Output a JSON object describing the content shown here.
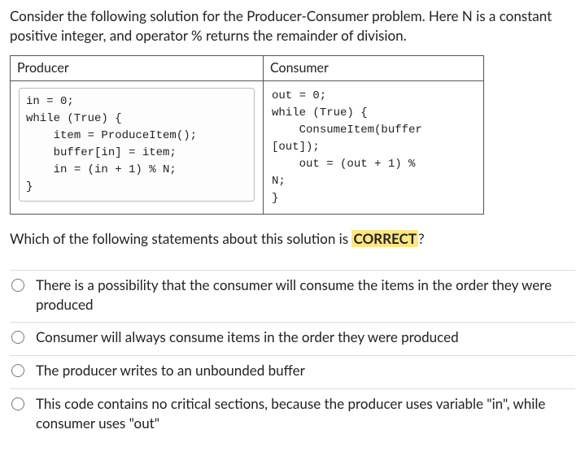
{
  "intro": "Consider the following solution for the Producer-Consumer problem. Here N is a constant positive integer, and operator % returns the remainder of division.",
  "table": {
    "headers": {
      "producer": "Producer",
      "consumer": "Consumer"
    },
    "producer_code": "in = 0;\nwhile (True) {\n    item = ProduceItem();\n    buffer[in] = item;\n    in = (in + 1) % N;\n}",
    "consumer_code": "out = 0;\nwhile (True) {\n    ConsumeItem(buffer\n[out]);\n    out = (out + 1) % \nN;\n}"
  },
  "question_prefix": "Which of the following statements about this solution is ",
  "question_highlight": "CORRECT",
  "question_suffix": "?",
  "options": [
    "There is a possibility that the consumer will consume the items in the order they were produced",
    "Consumer will always consume items in the order they were produced",
    "The producer writes to an unbounded buffer",
    "This code contains no critical sections, because the producer uses variable \"in\", while consumer uses \"out\""
  ]
}
